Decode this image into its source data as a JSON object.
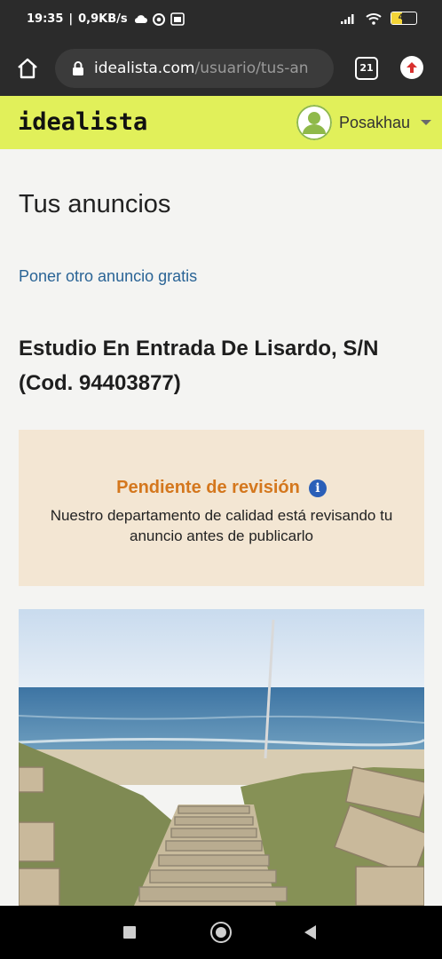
{
  "status_bar": {
    "time": "19:35",
    "net_speed": "0,9KB/s",
    "battery_level": "43",
    "battery_fraction": 0.43
  },
  "browser": {
    "url_host": "idealista.com",
    "url_path": "/usuario/tus-an",
    "tab_count": "21"
  },
  "site": {
    "logo": "idealista",
    "user_name": "Posakhau"
  },
  "page": {
    "title": "Tus anuncios",
    "post_link": "Poner otro anuncio gratis",
    "listing_title": "Estudio En Entrada De Lisardo, S/N (Cod. 94403877)"
  },
  "status": {
    "label": "Pendiente de revisión",
    "description": "Nuestro departamento de calidad está revisando tu anuncio antes de publicarlo"
  },
  "colors": {
    "header_bg": "#e1f05a",
    "link": "#2a6496",
    "status_label": "#d4771d",
    "status_card_bg": "#f3e6d3",
    "info_icon": "#2a5fb8"
  },
  "icons": {
    "home": "home-icon",
    "lock": "lock-icon",
    "tabs": "tabs-icon",
    "extension": "upload-extension-icon",
    "info": "info-icon",
    "avatar": "user-avatar-icon"
  }
}
